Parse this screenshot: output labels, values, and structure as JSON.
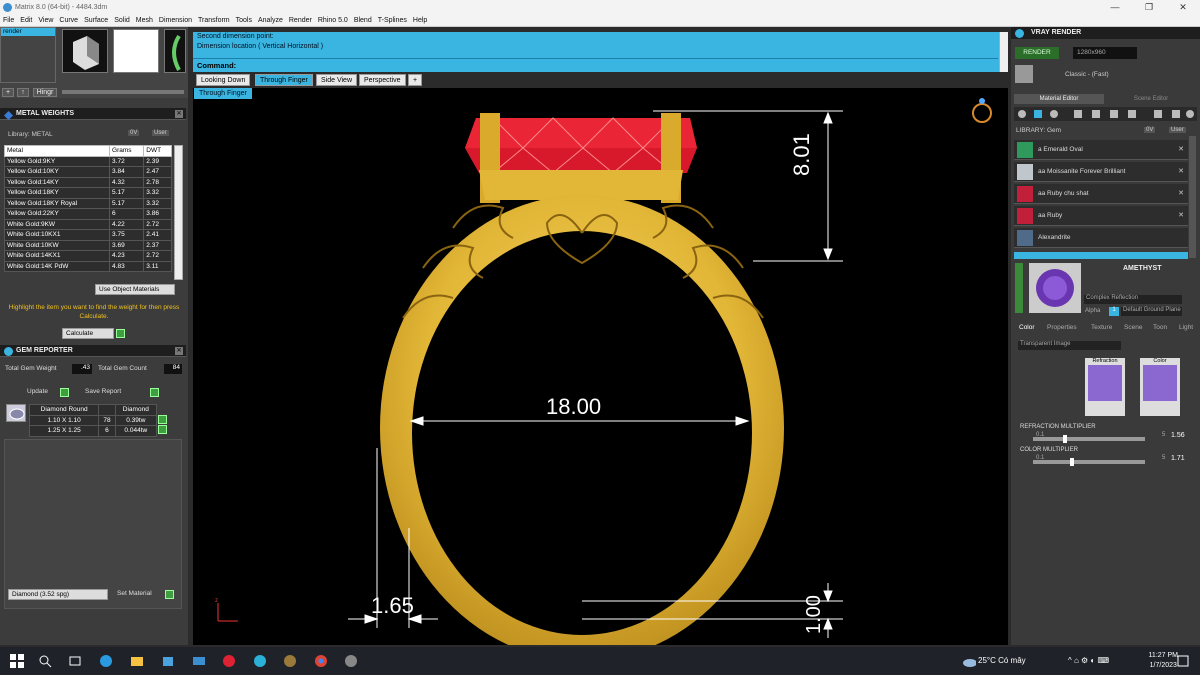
{
  "window": {
    "title": "Matrix 8.0 (64-bit) - 4484.3dm"
  },
  "menu": [
    "File",
    "Edit",
    "View",
    "Curve",
    "Surface",
    "Solid",
    "Mesh",
    "Dimension",
    "Transform",
    "Tools",
    "Analyze",
    "Render",
    "Rhino 5.0",
    "Blend",
    "T-Splines",
    "Help"
  ],
  "left": {
    "layer_label": "render",
    "mini_buttons": {
      "add": "+",
      "up": "↑",
      "hingr": "Hingr"
    },
    "metal_weights": {
      "title": "METAL WEIGHTS",
      "library_label": "Library: METAL",
      "chk_0v": "0V",
      "chk_user": "User",
      "columns": [
        "Metal",
        "Grams",
        "DWT"
      ],
      "rows": [
        [
          "Yellow Gold:9KY",
          "3.72",
          "2.39"
        ],
        [
          "Yellow Gold:10KY",
          "3.84",
          "2.47"
        ],
        [
          "Yellow Gold:14KY",
          "4.32",
          "2.78"
        ],
        [
          "Yellow Gold:18KY",
          "5.17",
          "3.32"
        ],
        [
          "Yellow Gold:18KY Royal",
          "5.17",
          "3.32"
        ],
        [
          "Yellow Gold:22KY",
          "6",
          "3.86"
        ],
        [
          "White Gold:9KW",
          "4.22",
          "2.72"
        ],
        [
          "White Gold:10KX1",
          "3.75",
          "2.41"
        ],
        [
          "White Gold:10KW",
          "3.69",
          "2.37"
        ],
        [
          "White Gold:14KX1",
          "4.23",
          "2.72"
        ],
        [
          "White Gold:14K PdW",
          "4.83",
          "3.11"
        ]
      ],
      "use_object_materials": "Use Object Materials",
      "hint": "Highlight the item you want to find the weight for then press Calculate.",
      "calculate": "Calculate"
    },
    "gem_reporter": {
      "title": "GEM REPORTER",
      "total_weight_label": "Total Gem Weight",
      "total_weight": ".43",
      "total_count_label": "Total Gem Count",
      "total_count": "84",
      "update": "Update",
      "save_report": "Save Report",
      "columns": [
        "Diamond Round",
        "",
        "Diamond"
      ],
      "rows": [
        [
          "1.10 X 1.10",
          "78",
          "0.39tw"
        ],
        [
          "1.25 X 1.25",
          "6",
          "0.044tw"
        ]
      ]
    },
    "material_select": "Diamond     (3.52 spg)",
    "set_material": "Set Material"
  },
  "command": {
    "line1": "Second dimension point:",
    "line2": "Dimension location ( Vertical  Horizontal )",
    "prompt": "Command:"
  },
  "viewport": {
    "tabs": [
      "Looking Down",
      "Through Finger",
      "Side View",
      "Perspective"
    ],
    "add_tab": "+",
    "label": "Through Finger",
    "dims": {
      "height": "8.01",
      "width": "18.00",
      "thickness": "1.65",
      "base": "1.00"
    },
    "axis_label": "z"
  },
  "right": {
    "title": "VRAY RENDER",
    "render_btn": "RENDER",
    "resolution": "1280x960",
    "preset_label": "Classic - (Fast)",
    "tabs": [
      "Material Editor",
      "Scene Editor"
    ],
    "library_label": "LIBRARY: Gem",
    "chk_0v": "0V",
    "chk_user": "User",
    "materials": [
      {
        "name": "a Emerald Oval",
        "color": "#2f9a5c"
      },
      {
        "name": "aa Moissanite Forever Brilliant",
        "color": "#bfc6cc"
      },
      {
        "name": "aa Ruby chu shat",
        "color": "#c0203a"
      },
      {
        "name": "aa Ruby",
        "color": "#c0203a"
      },
      {
        "name": "Alexandrite",
        "color": "#506a8a"
      }
    ],
    "selected_material": "AMETHYST",
    "shader": "Complex Reflection",
    "alpha_label": "Alpha",
    "alpha_value": "1",
    "ground": "Default Ground Plane",
    "sub_tabs": [
      "Color",
      "Properties",
      "Texture",
      "Scene",
      "Toon",
      "Light"
    ],
    "transparent_image": "Transparent Image",
    "refraction_label": "Refraction",
    "color_label": "Color",
    "refraction_multiplier_label": "REFRACTION MULTIPLIER",
    "refraction_min": "0.1",
    "refraction_max": "5",
    "refraction_value": "1.56",
    "refraction_level": 0.27,
    "color_multiplier_label": "COLOR MULTIPLIER",
    "color_min": "0.1",
    "color_max": "5",
    "color_value": "1.71",
    "color_level": 0.33
  },
  "taskbar": {
    "weather": "25°C  Có mây",
    "time": "11:27 PM",
    "date": "1/7/2023"
  },
  "colors": {
    "accent": "#3ab4e0",
    "gold": "#e2b636",
    "ruby": "#d7192b"
  }
}
